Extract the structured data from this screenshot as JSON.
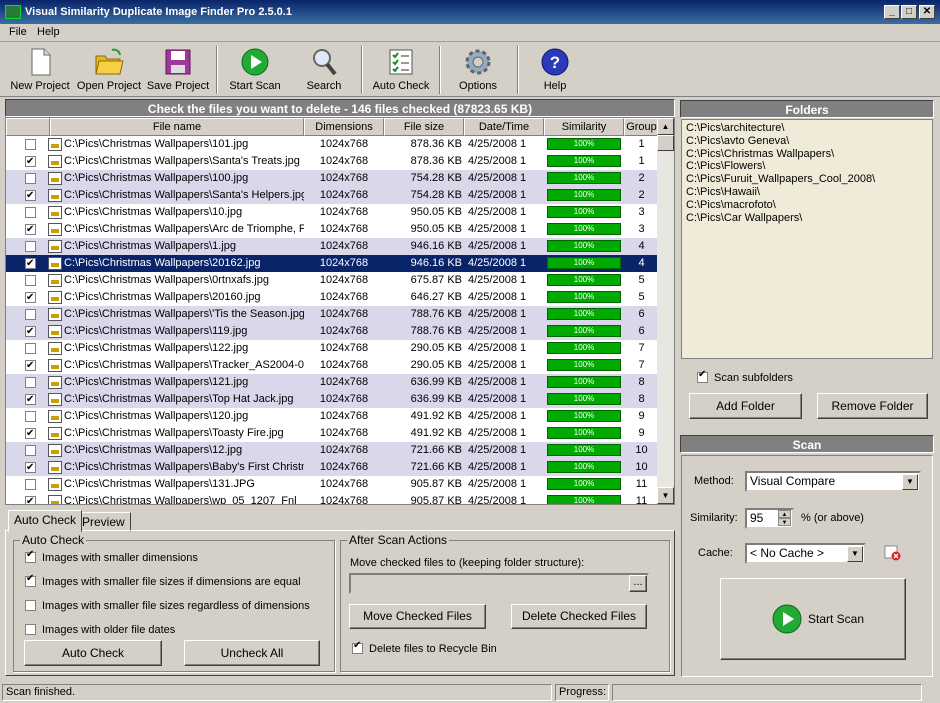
{
  "window": {
    "title": "Visual Similarity Duplicate Image Finder Pro 2.5.0.1"
  },
  "menu": [
    "File",
    "Help"
  ],
  "toolbar": [
    {
      "label": "New Project",
      "icon": "new-document-icon"
    },
    {
      "label": "Open Project",
      "icon": "folder-open-icon"
    },
    {
      "label": "Save Project",
      "icon": "save-disk-icon"
    },
    {
      "label": "Start Scan",
      "icon": "play-icon"
    },
    {
      "label": "Search",
      "icon": "magnifier-icon"
    },
    {
      "label": "Auto Check",
      "icon": "checklist-icon"
    },
    {
      "label": "Options",
      "icon": "gear-icon"
    },
    {
      "label": "Help",
      "icon": "help-icon"
    }
  ],
  "results": {
    "header": "Check the files you want to delete - 146 files checked (87823.65 KB)",
    "columns": [
      "File name",
      "Dimensions",
      "File size",
      "Date/Time",
      "Similarity",
      "Group"
    ],
    "rows": [
      {
        "checked": false,
        "name": "C:\\Pics\\Christmas Wallpapers\\101.jpg",
        "dim": "1024x768",
        "size": "878.36 KB",
        "date": "4/25/2008 1",
        "sim": "100%",
        "group": "1"
      },
      {
        "checked": true,
        "name": "C:\\Pics\\Christmas Wallpapers\\Santa's Treats.jpg",
        "dim": "1024x768",
        "size": "878.36 KB",
        "date": "4/25/2008 1",
        "sim": "100%",
        "group": "1"
      },
      {
        "checked": false,
        "name": "C:\\Pics\\Christmas Wallpapers\\100.jpg",
        "dim": "1024x768",
        "size": "754.28 KB",
        "date": "4/25/2008 1",
        "sim": "100%",
        "group": "2"
      },
      {
        "checked": true,
        "name": "C:\\Pics\\Christmas Wallpapers\\Santa's Helpers.jpg",
        "dim": "1024x768",
        "size": "754.28 KB",
        "date": "4/25/2008 1",
        "sim": "100%",
        "group": "2"
      },
      {
        "checked": false,
        "name": "C:\\Pics\\Christmas Wallpapers\\10.jpg",
        "dim": "1024x768",
        "size": "950.05 KB",
        "date": "4/25/2008 1",
        "sim": "100%",
        "group": "3"
      },
      {
        "checked": true,
        "name": "C:\\Pics\\Christmas Wallpapers\\Arc de Triomphe, F",
        "dim": "1024x768",
        "size": "950.05 KB",
        "date": "4/25/2008 1",
        "sim": "100%",
        "group": "3"
      },
      {
        "checked": false,
        "name": "C:\\Pics\\Christmas Wallpapers\\1.jpg",
        "dim": "1024x768",
        "size": "946.16 KB",
        "date": "4/25/2008 1",
        "sim": "100%",
        "group": "4"
      },
      {
        "checked": true,
        "name": "C:\\Pics\\Christmas Wallpapers\\20162.jpg",
        "dim": "1024x768",
        "size": "946.16 KB",
        "date": "4/25/2008 1",
        "sim": "100%",
        "group": "4"
      },
      {
        "checked": false,
        "name": "C:\\Pics\\Christmas Wallpapers\\0rtnxafs.jpg",
        "dim": "1024x768",
        "size": "675.87 KB",
        "date": "4/25/2008 1",
        "sim": "100%",
        "group": "5"
      },
      {
        "checked": true,
        "name": "C:\\Pics\\Christmas Wallpapers\\20160.jpg",
        "dim": "1024x768",
        "size": "646.27 KB",
        "date": "4/25/2008 1",
        "sim": "100%",
        "group": "5"
      },
      {
        "checked": false,
        "name": "C:\\Pics\\Christmas Wallpapers\\'Tis the Season.jpg",
        "dim": "1024x768",
        "size": "788.76 KB",
        "date": "4/25/2008 1",
        "sim": "100%",
        "group": "6"
      },
      {
        "checked": true,
        "name": "C:\\Pics\\Christmas Wallpapers\\119.jpg",
        "dim": "1024x768",
        "size": "788.76 KB",
        "date": "4/25/2008 1",
        "sim": "100%",
        "group": "6"
      },
      {
        "checked": false,
        "name": "C:\\Pics\\Christmas Wallpapers\\122.jpg",
        "dim": "1024x768",
        "size": "290.05 KB",
        "date": "4/25/2008 1",
        "sim": "100%",
        "group": "7"
      },
      {
        "checked": true,
        "name": "C:\\Pics\\Christmas Wallpapers\\Tracker_AS2004-0",
        "dim": "1024x768",
        "size": "290.05 KB",
        "date": "4/25/2008 1",
        "sim": "100%",
        "group": "7"
      },
      {
        "checked": false,
        "name": "C:\\Pics\\Christmas Wallpapers\\121.jpg",
        "dim": "1024x768",
        "size": "636.99 KB",
        "date": "4/25/2008 1",
        "sim": "100%",
        "group": "8"
      },
      {
        "checked": true,
        "name": "C:\\Pics\\Christmas Wallpapers\\Top Hat Jack.jpg",
        "dim": "1024x768",
        "size": "636.99 KB",
        "date": "4/25/2008 1",
        "sim": "100%",
        "group": "8"
      },
      {
        "checked": false,
        "name": "C:\\Pics\\Christmas Wallpapers\\120.jpg",
        "dim": "1024x768",
        "size": "491.92 KB",
        "date": "4/25/2008 1",
        "sim": "100%",
        "group": "9"
      },
      {
        "checked": true,
        "name": "C:\\Pics\\Christmas Wallpapers\\Toasty Fire.jpg",
        "dim": "1024x768",
        "size": "491.92 KB",
        "date": "4/25/2008 1",
        "sim": "100%",
        "group": "9"
      },
      {
        "checked": false,
        "name": "C:\\Pics\\Christmas Wallpapers\\12.jpg",
        "dim": "1024x768",
        "size": "721.66 KB",
        "date": "4/25/2008 1",
        "sim": "100%",
        "group": "10"
      },
      {
        "checked": true,
        "name": "C:\\Pics\\Christmas Wallpapers\\Baby's First Christm",
        "dim": "1024x768",
        "size": "721.66 KB",
        "date": "4/25/2008 1",
        "sim": "100%",
        "group": "10"
      },
      {
        "checked": false,
        "name": "C:\\Pics\\Christmas Wallpapers\\131.JPG",
        "dim": "1024x768",
        "size": "905.87 KB",
        "date": "4/25/2008 1",
        "sim": "100%",
        "group": "11"
      },
      {
        "checked": true,
        "name": "C:\\Pics\\Christmas Wallpapers\\wp_05_1207_Fnl",
        "dim": "1024x768",
        "size": "905.87 KB",
        "date": "4/25/2008 1",
        "sim": "100%",
        "group": "11"
      }
    ]
  },
  "tabs": [
    "Auto Check",
    "Preview"
  ],
  "autocheck": {
    "title": "Auto Check",
    "options": [
      {
        "label": "Images with smaller dimensions",
        "checked": true
      },
      {
        "label": "Images with smaller file sizes if dimensions are equal",
        "checked": true
      },
      {
        "label": "Images with smaller file sizes regardless of dimensions",
        "checked": false
      },
      {
        "label": "Images with older file dates",
        "checked": false
      }
    ],
    "auto_check_btn": "Auto Check",
    "uncheck_all_btn": "Uncheck All"
  },
  "after_scan": {
    "title": "After Scan Actions",
    "move_label": "Move checked files to (keeping folder structure):",
    "move_value": "",
    "browse": "...",
    "move_btn": "Move Checked Files",
    "delete_btn": "Delete Checked Files",
    "recycle_label": "Delete files to Recycle Bin",
    "recycle_checked": true
  },
  "folders": {
    "header": "Folders",
    "items": [
      "C:\\Pics\\architecture\\",
      "C:\\Pics\\avto Geneva\\",
      "C:\\Pics\\Christmas Wallpapers\\",
      "C:\\Pics\\Flowers\\",
      "C:\\Pics\\Furuit_Wallpapers_Cool_2008\\",
      "C:\\Pics\\Hawaii\\",
      "C:\\Pics\\macrofoto\\",
      "C:\\Pics\\Car Wallpapers\\"
    ],
    "scan_subfolders": "Scan subfolders",
    "add_btn": "Add Folder",
    "remove_btn": "Remove Folder"
  },
  "scan": {
    "header": "Scan",
    "method_label": "Method:",
    "method_value": "Visual Compare",
    "similarity_label": "Similarity:",
    "similarity_value": "95",
    "similarity_suffix": "% (or above)",
    "cache_label": "Cache:",
    "cache_value": "< No Cache >",
    "start_btn": "Start Scan"
  },
  "status": {
    "left": "Scan finished.",
    "progress_label": "Progress:"
  }
}
